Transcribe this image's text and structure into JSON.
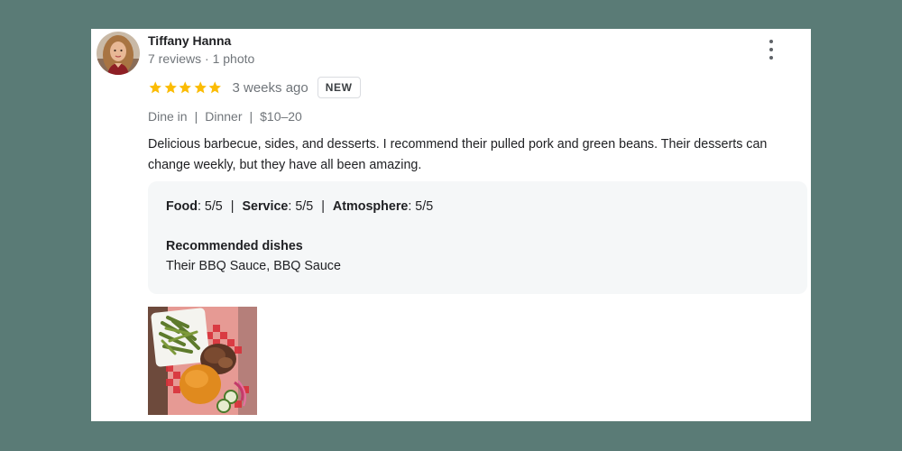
{
  "review": {
    "author_name": "Tiffany Hanna",
    "author_meta": "7 reviews · 1 photo",
    "star_rating": 5,
    "star_color": "#fbbc04",
    "time_ago": "3 weeks ago",
    "badge": "NEW",
    "attributes": [
      "Dine in",
      "Dinner",
      "$10–20"
    ],
    "attribute_separator": "|",
    "text": "Delicious barbecue, sides, and desserts. I recommend their pulled pork and green beans. Their desserts can change weekly, but they have all been amazing.",
    "scores": {
      "food_label": "Food",
      "food_value": ": 5/5",
      "service_label": "Service",
      "service_value": ": 5/5",
      "atmosphere_label": "Atmosphere",
      "atmosphere_value": ": 5/5",
      "separator": "|"
    },
    "recommended": {
      "title": "Recommended dishes",
      "dishes": "Their BBQ Sauce, BBQ Sauce"
    },
    "more_icon": "more-vert-icon"
  }
}
